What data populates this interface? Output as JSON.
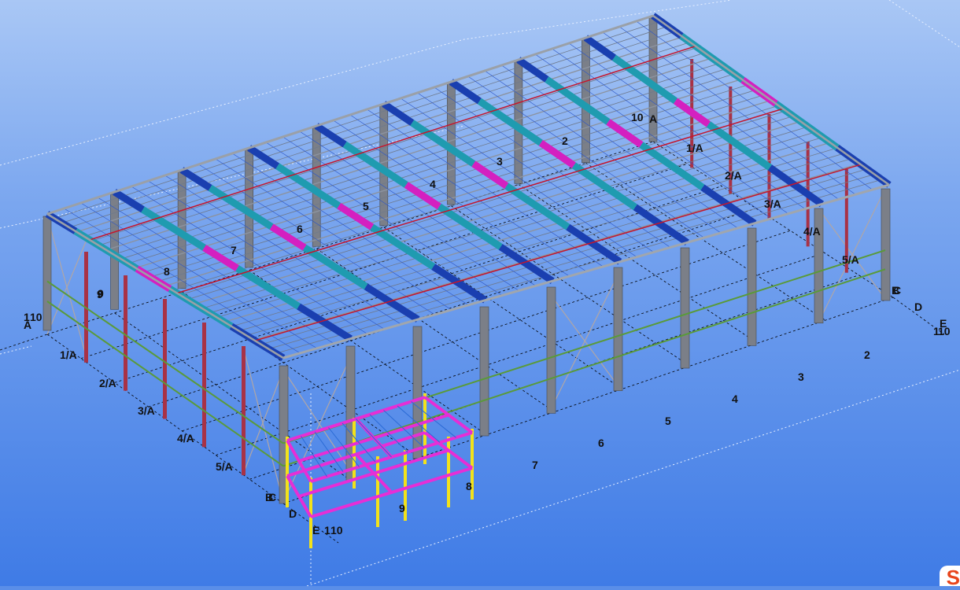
{
  "viewport": {
    "colors": {
      "background_top": "#a9c7f5",
      "background_bottom": "#3f7be6",
      "grid_line": "#000000",
      "workarea_outline": "#e8f0ff",
      "column": "#7b7f88",
      "edge_column": "#a83246",
      "rafter_blue": "#1a3fb0",
      "rafter_teal": "#1f9bb0",
      "rafter_magenta": "#d420c0",
      "purlin": "#8a8f99",
      "girt_green": "#5a9a3a",
      "eave_red": "#c4162c",
      "mezzanine_beam": "#e62ed6",
      "mezzanine_column": "#f2e21a",
      "bracing": "#b0a6a6"
    },
    "grid_labels": {
      "far": [
        "10",
        "A",
        "2",
        "3",
        "4",
        "5",
        "6",
        "7",
        "8",
        "9",
        "1/A",
        "2/A",
        "3/A",
        "4/A",
        "5/A"
      ],
      "left": [
        "1",
        "10",
        "A",
        "9",
        "1/A",
        "2/A",
        "3/A",
        "4/A",
        "5/A",
        "B",
        "C",
        "D",
        "E",
        "1",
        "10"
      ],
      "right": [
        "B",
        "C",
        "D",
        "E",
        "1",
        "10",
        "2",
        "3",
        "4",
        "5",
        "6",
        "7",
        "8",
        "9"
      ]
    }
  },
  "brand": {
    "icon": "tekla-logo-icon",
    "glyph": "S"
  }
}
